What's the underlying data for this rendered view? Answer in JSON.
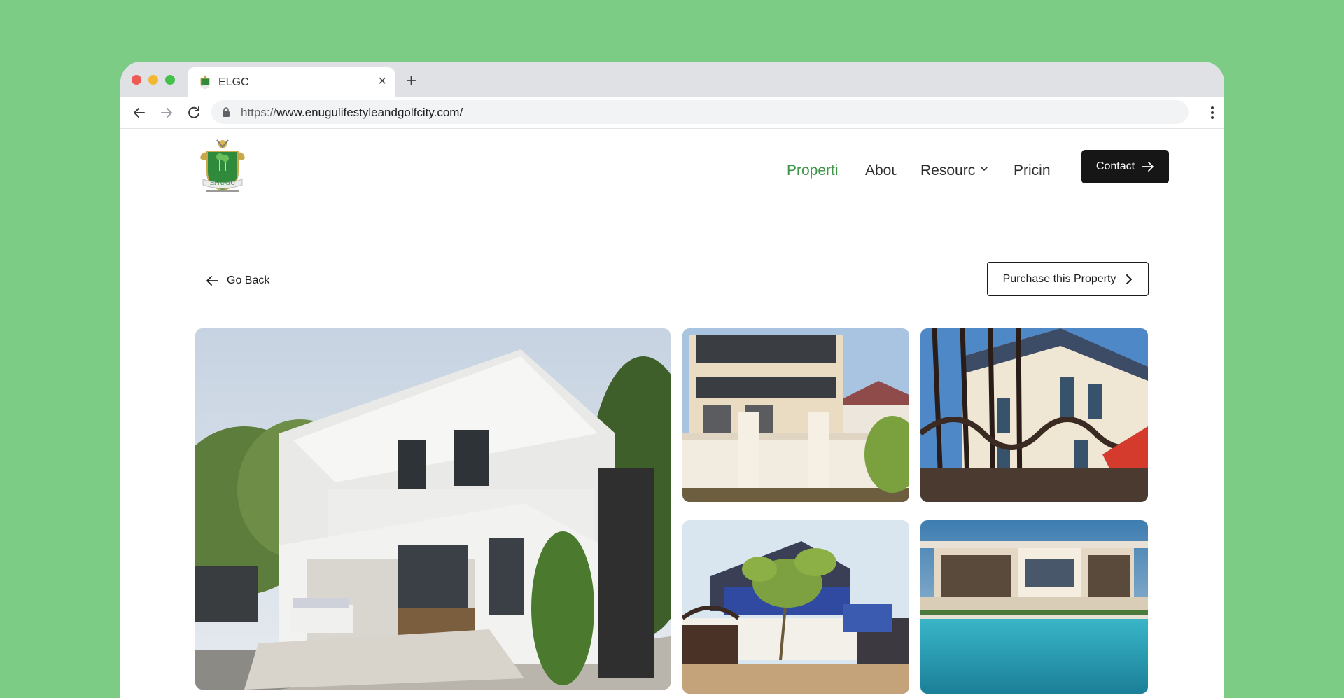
{
  "browser": {
    "tab_title": "ELGC",
    "url_scheme": "https://",
    "url_rest": "www.enugulifestyleandgolfcity.com/"
  },
  "nav": {
    "items": [
      {
        "label": "Properti",
        "active": true
      },
      {
        "label": "Abou",
        "active": false
      },
      {
        "label": "Resourc",
        "active": false
      },
      {
        "label": "Pricin",
        "active": false
      }
    ],
    "contact_label": "Contact"
  },
  "page": {
    "go_back_label": "Go Back",
    "purchase_label": "Purchase this Property"
  },
  "gallery": {
    "images": [
      "modern-white-house-exterior",
      "multi-storey-cream-villa",
      "villa-behind-iron-gate",
      "house-with-tree-and-gate",
      "luxury-house-with-pool"
    ]
  },
  "colors": {
    "background": "#7dcc86",
    "accent_green": "#3d9447",
    "button_dark": "#161616"
  }
}
